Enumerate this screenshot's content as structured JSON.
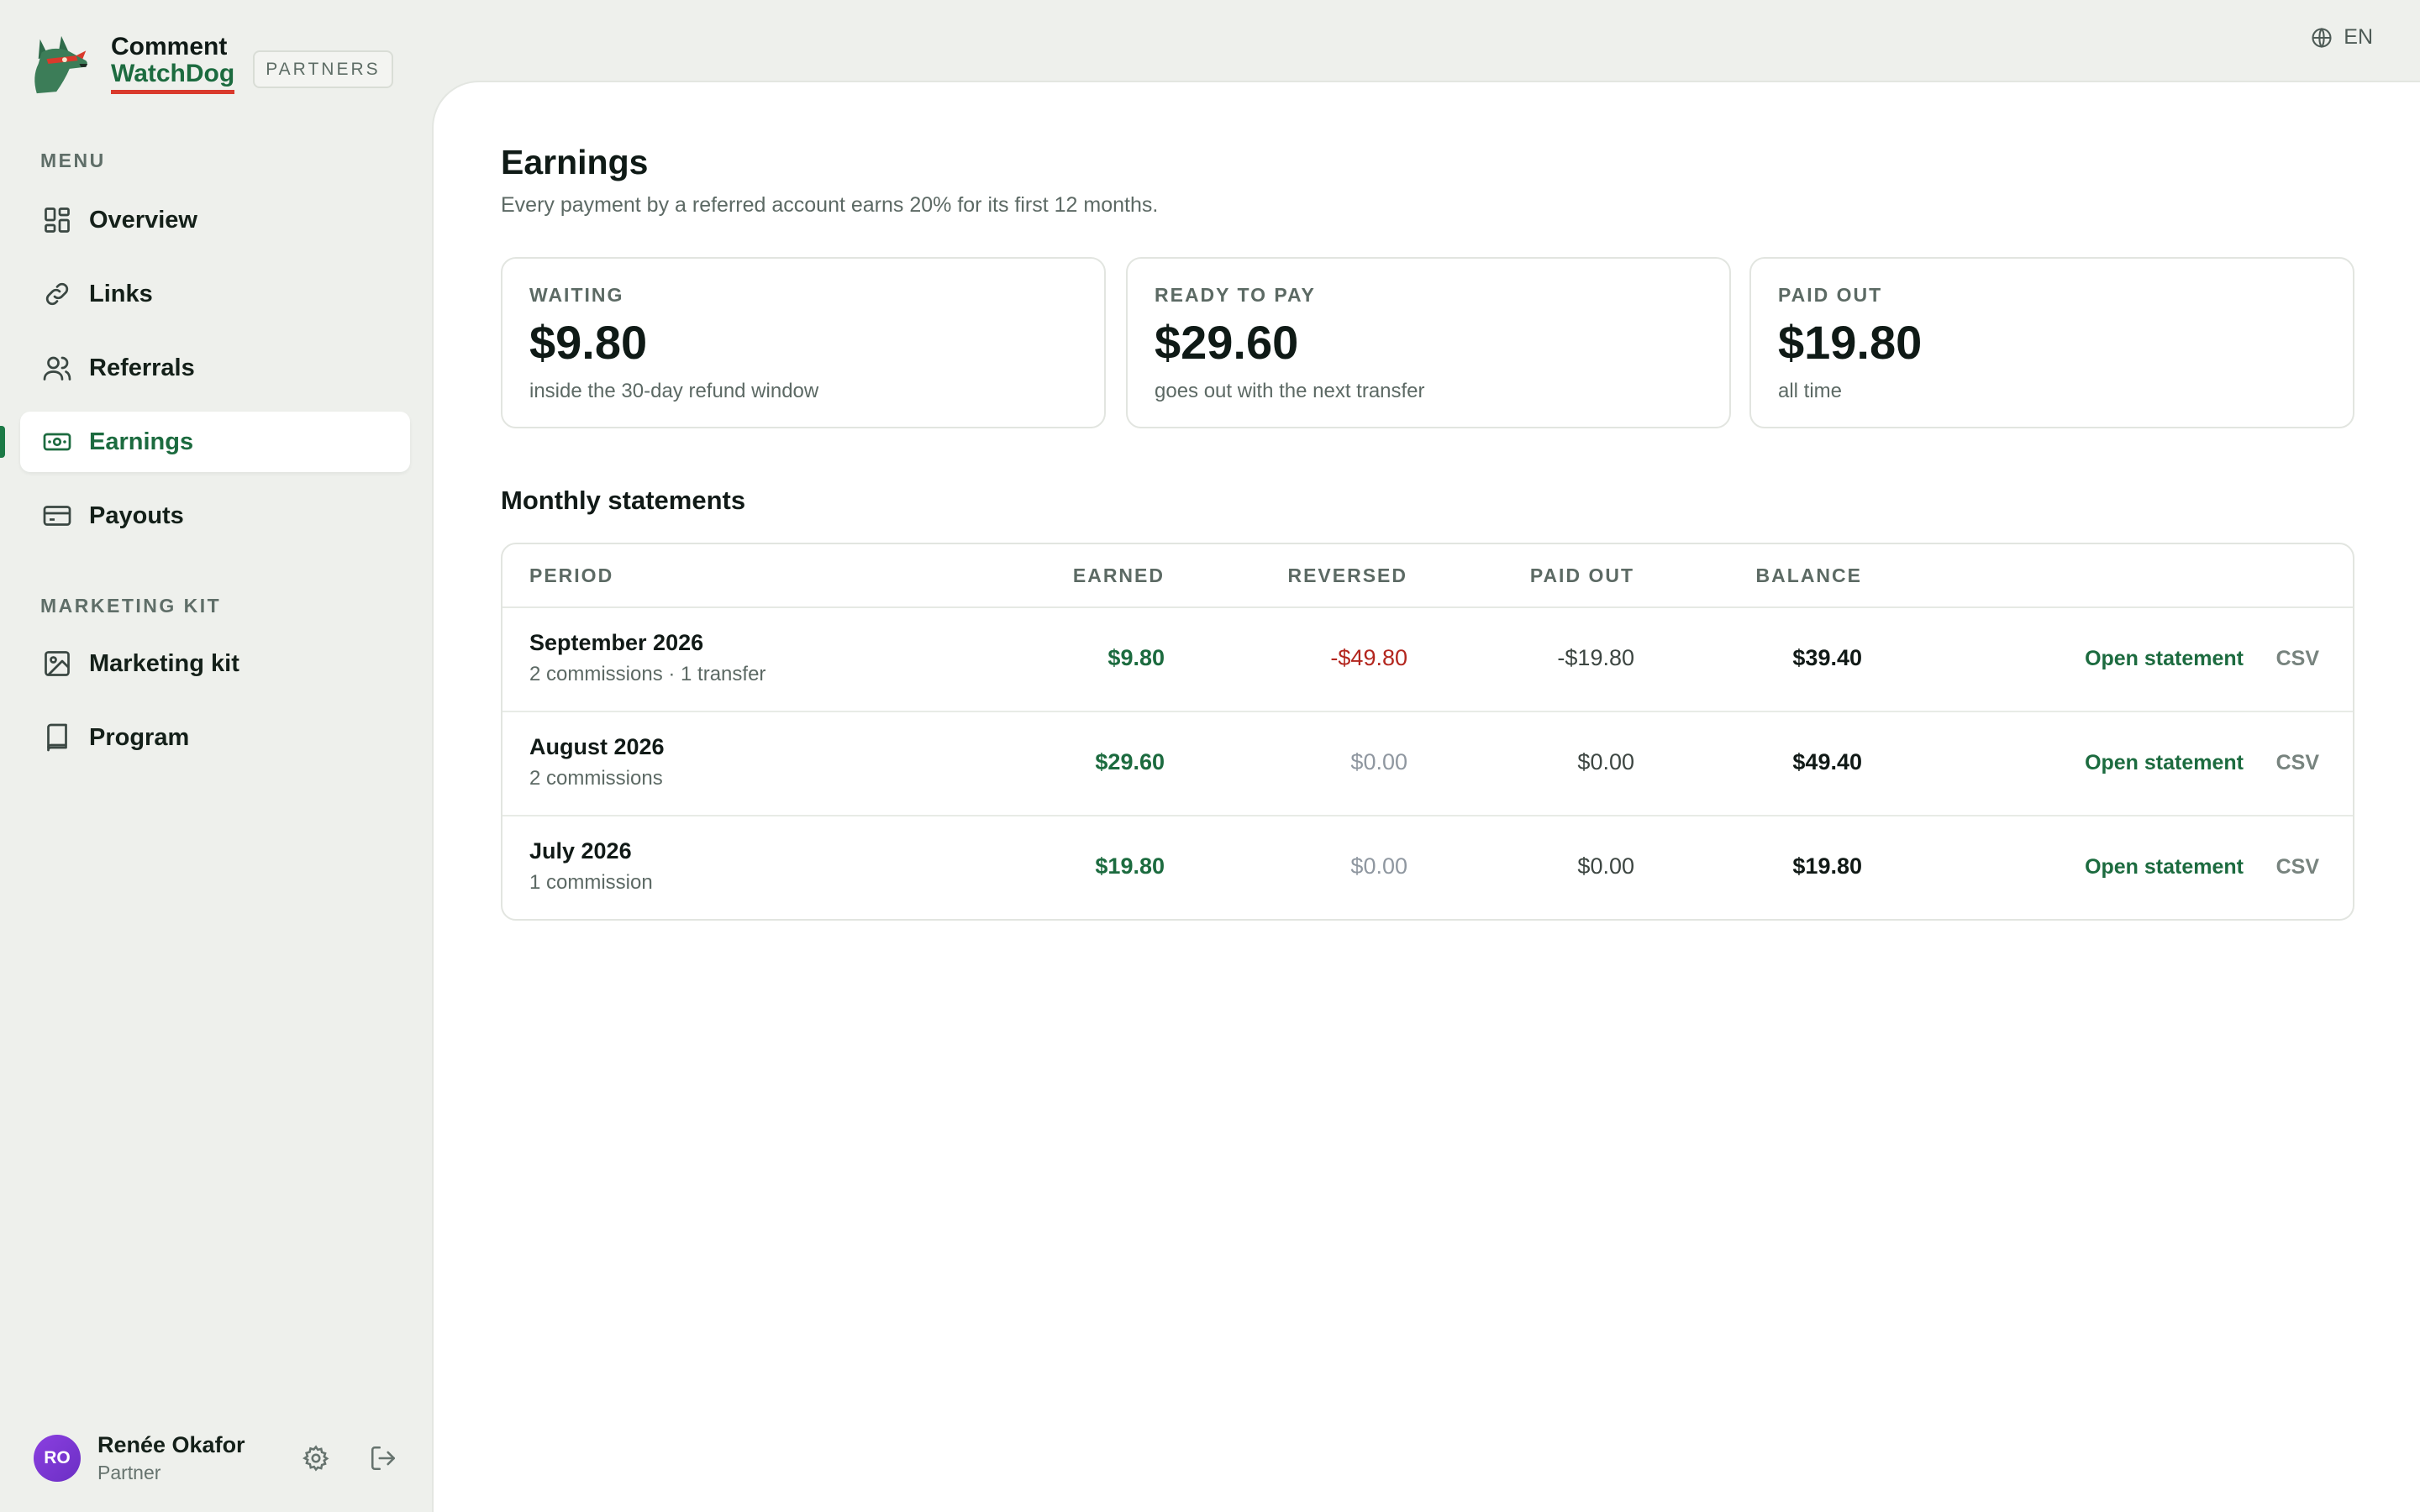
{
  "brand": {
    "line1": "Comment",
    "line2": "WatchDog",
    "badge": "PARTNERS"
  },
  "language": {
    "label": "EN",
    "icon": "globe-icon"
  },
  "sidebar": {
    "menu_label": "MENU",
    "items": [
      {
        "label": "Overview",
        "icon": "grid-icon"
      },
      {
        "label": "Links",
        "icon": "link-icon"
      },
      {
        "label": "Referrals",
        "icon": "users-icon"
      },
      {
        "label": "Earnings",
        "icon": "banknote-icon",
        "active": true
      },
      {
        "label": "Payouts",
        "icon": "card-icon"
      }
    ],
    "kit_label": "MARKETING KIT",
    "kit_items": [
      {
        "label": "Marketing kit",
        "icon": "image-icon"
      },
      {
        "label": "Program",
        "icon": "book-icon"
      }
    ]
  },
  "user": {
    "initials": "RO",
    "name": "Renée Okafor",
    "role": "Partner"
  },
  "page": {
    "title": "Earnings",
    "subtitle": "Every payment by a referred account earns 20% for its first 12 months."
  },
  "cards": [
    {
      "label": "WAITING",
      "value": "$9.80",
      "note": "inside the 30-day refund window"
    },
    {
      "label": "READY TO PAY",
      "value": "$29.60",
      "note": "goes out with the next transfer"
    },
    {
      "label": "PAID OUT",
      "value": "$19.80",
      "note": "all time"
    }
  ],
  "statements": {
    "title": "Monthly statements",
    "headers": {
      "period": "PERIOD",
      "earned": "EARNED",
      "reversed": "REVERSED",
      "paid": "PAID OUT",
      "balance": "BALANCE"
    },
    "open_label": "Open statement",
    "csv_label": "CSV",
    "rows": [
      {
        "period": "September 2026",
        "sub": "2 commissions · 1 transfer",
        "earned": "$9.80",
        "reversed": "-$49.80",
        "paid": "-$19.80",
        "balance": "$39.40"
      },
      {
        "period": "August 2026",
        "sub": "2 commissions",
        "earned": "$29.60",
        "reversed": "$0.00",
        "paid": "$0.00",
        "balance": "$49.40"
      },
      {
        "period": "July 2026",
        "sub": "1 commission",
        "earned": "$19.80",
        "reversed": "$0.00",
        "paid": "$0.00",
        "balance": "$19.80"
      }
    ]
  },
  "colors": {
    "accent": "#1c6b3f",
    "negative": "#b3261e",
    "brand_underline": "#d93a2c"
  }
}
